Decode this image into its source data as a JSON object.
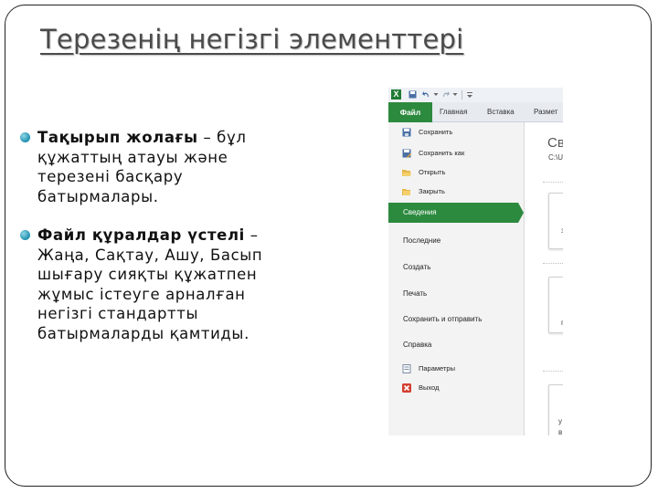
{
  "slide": {
    "title": "Терезенің негізгі элементтері",
    "bullets": [
      {
        "term": "Тақырып жолағы",
        "text": " – бұл құжаттың атауы және терезені басқару батырмалары."
      },
      {
        "term": "Файл құралдар үстелі",
        "text": " – Жаңа, Сақтау, Ашу, Басып шығару сияқты құжатпен жұмыс істеуге арналған негізгі стандартты батырмаларды қамтиды."
      }
    ]
  },
  "screenshot": {
    "app_icon": "X",
    "tabs": [
      "Файл",
      "Главная",
      "Вставка",
      "Размет"
    ],
    "menu": {
      "save": "Сохранить",
      "save_as": "Сохранить как",
      "open": "Открыть",
      "close": "Закрыть",
      "info": "Сведения",
      "recent": "Последние",
      "new": "Создать",
      "print": "Печать",
      "save_send": "Сохранить и отправить",
      "help": "Справка",
      "options": "Параметры",
      "exit": "Выход"
    },
    "right_title": "Све",
    "right_path": "C:\\U",
    "card_letters": [
      "з",
      "п",
      "у",
      "в"
    ]
  },
  "colors": {
    "accent_green": "#2c8a3e",
    "bullet": "#1d8fb0"
  }
}
